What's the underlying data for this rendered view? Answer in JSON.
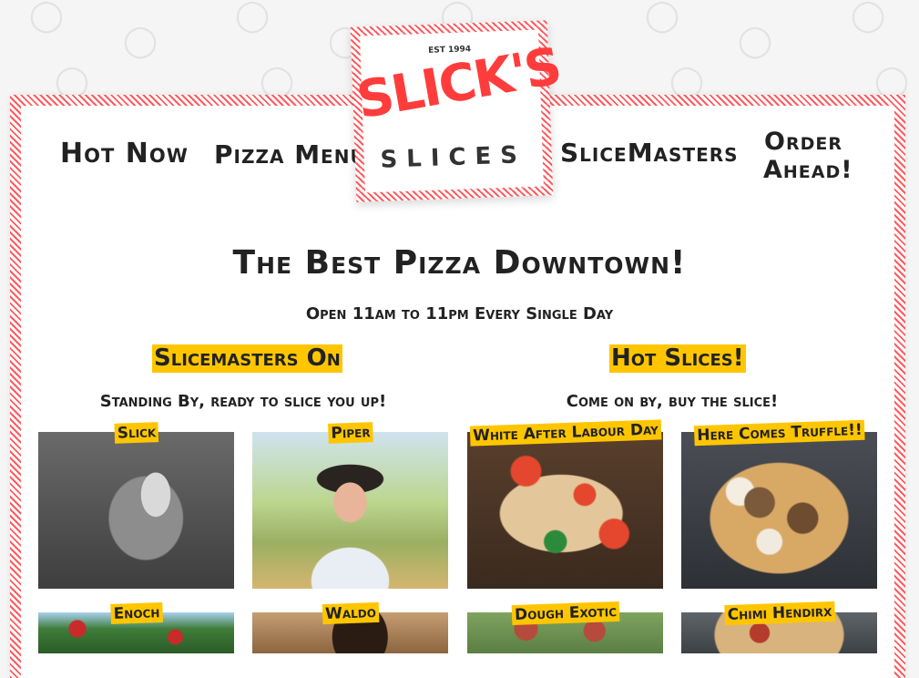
{
  "nav": {
    "hot_now": "Hot Now",
    "pizza_menu": "Pizza Menu",
    "slicemasters": "SliceMasters",
    "order_ahead": "Order Ahead!"
  },
  "logo": {
    "est": "EST 1994",
    "name_top": "SLICK'S",
    "name_bottom": "SLICES"
  },
  "hero": {
    "title": "The Best Pizza Downtown!",
    "subtitle": "Open 11am to 11pm Every Single Day"
  },
  "slicemasters": {
    "heading": "Slicemasters On",
    "subheading": "Standing By, ready to slice you up!",
    "people": [
      {
        "name": "Slick"
      },
      {
        "name": "Piper"
      },
      {
        "name": "Enoch"
      },
      {
        "name": "Waldo"
      }
    ]
  },
  "hot_slices": {
    "heading": "Hot Slices!",
    "subheading": "Come on by, buy the slice!",
    "pizzas": [
      {
        "name": "White After Labour Day"
      },
      {
        "name": "Here Comes Truffle!!"
      },
      {
        "name": "Dough Exotic"
      },
      {
        "name": "Chimi Hendirx"
      }
    ]
  },
  "colors": {
    "accent_red": "#ff3c3c",
    "highlight_yellow": "#ffc600",
    "text": "#222222"
  }
}
